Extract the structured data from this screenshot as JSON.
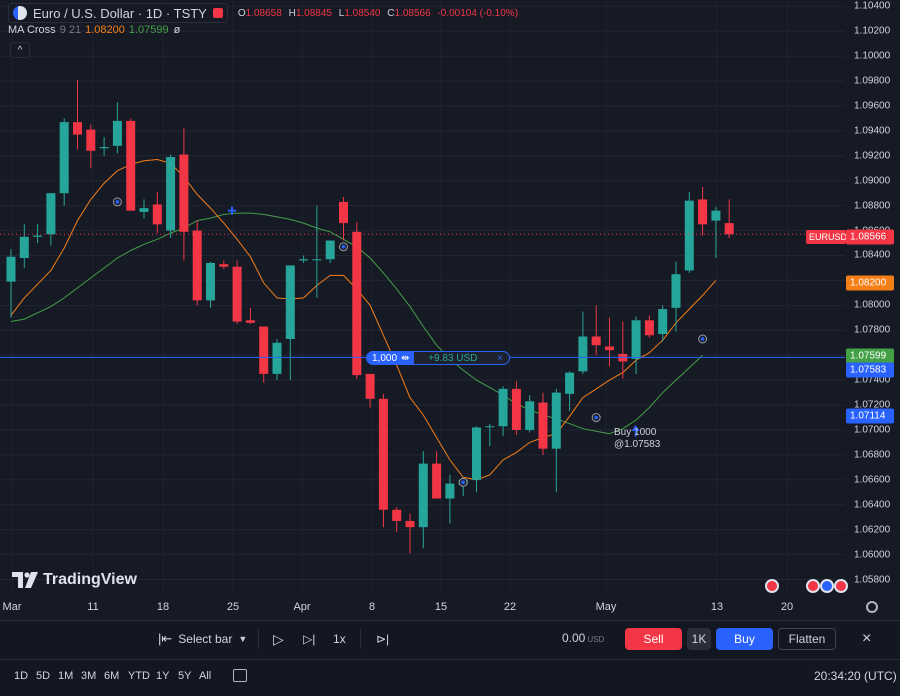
{
  "header": {
    "symbol_title": "Euro / U.S. Dollar · 1D · TSTY",
    "ohlc": {
      "o_label": "O",
      "o": "1.08658",
      "h_label": "H",
      "h": "1.08845",
      "l_label": "L",
      "l": "1.08540",
      "c_label": "C",
      "c": "1.08566",
      "change": "-0.00104 (-0.10%)"
    },
    "indicator": {
      "name": "MA Cross",
      "params": "9 21",
      "fast_value": "1.08200",
      "slow_value": "1.07599",
      "symbol": "ø"
    },
    "collapse_symbol": "^"
  },
  "price_axis": [
    "1.10400",
    "1.10200",
    "1.10000",
    "1.09800",
    "1.09600",
    "1.09400",
    "1.09200",
    "1.09000",
    "1.08800",
    "1.08600",
    "1.08400",
    "1.08200",
    "1.08000",
    "1.07800",
    "1.07600",
    "1.07400",
    "1.07200",
    "1.07000",
    "1.06800",
    "1.06600",
    "1.06400",
    "1.06200",
    "1.06000",
    "1.05800"
  ],
  "time_axis": [
    "Mar",
    "11",
    "18",
    "25",
    "Apr",
    "8",
    "15",
    "22",
    "May",
    "13",
    "20"
  ],
  "price_tags": {
    "symbol_tag": "EURUSD",
    "current": "1.08566",
    "fast_ma": "1.08200",
    "slow_ma": "1.07599",
    "entry": "1.07583",
    "low_line": "1.07114"
  },
  "position": {
    "qty": "1,000",
    "pnl": "+9.83 USD",
    "close_symbol": "×",
    "arrow_symbol": "⇹"
  },
  "buy_marker": {
    "line1": "Buy 1000",
    "line2": "@1.07583"
  },
  "brand": {
    "logo_text": "TradingView"
  },
  "colors": {
    "up": "#26a69a",
    "down": "#f23645",
    "fast_ma": "#f57f17",
    "slow_ma": "#43a047",
    "accent": "#2962ff",
    "background": "#161a25"
  },
  "chart_data": {
    "type": "candlestick",
    "y_range": [
      1.057,
      1.1045
    ],
    "grid": true,
    "candles": [
      {
        "o": 1.0819,
        "h": 1.0845,
        "l": 1.079,
        "c": 1.0839
      },
      {
        "o": 1.0838,
        "h": 1.0865,
        "l": 1.083,
        "c": 1.0855
      },
      {
        "o": 1.0855,
        "h": 1.0865,
        "l": 1.085,
        "c": 1.0856
      },
      {
        "o": 1.0857,
        "h": 1.087,
        "l": 1.0848,
        "c": 1.089
      },
      {
        "o": 1.089,
        "h": 1.095,
        "l": 1.088,
        "c": 1.0947
      },
      {
        "o": 1.0947,
        "h": 1.0981,
        "l": 1.0925,
        "c": 1.0937
      },
      {
        "o": 1.0941,
        "h": 1.0945,
        "l": 1.091,
        "c": 1.0924
      },
      {
        "o": 1.0926,
        "h": 1.0935,
        "l": 1.092,
        "c": 1.0927
      },
      {
        "o": 1.0928,
        "h": 1.0963,
        "l": 1.0922,
        "c": 1.0948
      },
      {
        "o": 1.0948,
        "h": 1.095,
        "l": 1.0876,
        "c": 1.0876
      },
      {
        "o": 1.0875,
        "h": 1.0885,
        "l": 1.087,
        "c": 1.0878
      },
      {
        "o": 1.0881,
        "h": 1.0891,
        "l": 1.0858,
        "c": 1.0865
      },
      {
        "o": 1.086,
        "h": 1.0921,
        "l": 1.0854,
        "c": 1.0919
      },
      {
        "o": 1.0921,
        "h": 1.0942,
        "l": 1.0836,
        "c": 1.0859
      },
      {
        "o": 1.086,
        "h": 1.0868,
        "l": 1.08,
        "c": 1.0804
      },
      {
        "o": 1.0804,
        "h": 1.0835,
        "l": 1.0798,
        "c": 1.0834
      },
      {
        "o": 1.0833,
        "h": 1.0836,
        "l": 1.0829,
        "c": 1.0831
      },
      {
        "o": 1.0831,
        "h": 1.0836,
        "l": 1.0785,
        "c": 1.0787
      },
      {
        "o": 1.0788,
        "h": 1.0798,
        "l": 1.0785,
        "c": 1.0786
      },
      {
        "o": 1.0783,
        "h": 1.0781,
        "l": 1.0738,
        "c": 1.0745
      },
      {
        "o": 1.0745,
        "h": 1.0773,
        "l": 1.074,
        "c": 1.077
      },
      {
        "o": 1.0773,
        "h": 1.083,
        "l": 1.074,
        "c": 1.0832
      },
      {
        "o": 1.0836,
        "h": 1.084,
        "l": 1.0834,
        "c": 1.0837
      },
      {
        "o": 1.0837,
        "h": 1.088,
        "l": 1.0806,
        "c": 1.0837
      },
      {
        "o": 1.0837,
        "h": 1.0848,
        "l": 1.0834,
        "c": 1.0852
      },
      {
        "o": 1.0883,
        "h": 1.0887,
        "l": 1.0852,
        "c": 1.0866
      },
      {
        "o": 1.0859,
        "h": 1.0867,
        "l": 1.0741,
        "c": 1.0744
      },
      {
        "o": 1.0745,
        "h": 1.0745,
        "l": 1.0718,
        "c": 1.0725
      },
      {
        "o": 1.0725,
        "h": 1.0729,
        "l": 1.0622,
        "c": 1.0636
      },
      {
        "o": 1.0636,
        "h": 1.0638,
        "l": 1.0618,
        "c": 1.0627
      },
      {
        "o": 1.0627,
        "h": 1.0633,
        "l": 1.0601,
        "c": 1.0622
      },
      {
        "o": 1.0622,
        "h": 1.0683,
        "l": 1.0605,
        "c": 1.0673
      },
      {
        "o": 1.0673,
        "h": 1.0683,
        "l": 1.0645,
        "c": 1.0645
      },
      {
        "o": 1.0645,
        "h": 1.0664,
        "l": 1.0625,
        "c": 1.0657
      },
      {
        "o": 1.0656,
        "h": 1.0662,
        "l": 1.0647,
        "c": 1.066
      },
      {
        "o": 1.066,
        "h": 1.0703,
        "l": 1.065,
        "c": 1.0702
      },
      {
        "o": 1.0703,
        "h": 1.0705,
        "l": 1.0687,
        "c": 1.0703
      },
      {
        "o": 1.0703,
        "h": 1.0735,
        "l": 1.0695,
        "c": 1.0733
      },
      {
        "o": 1.0733,
        "h": 1.0739,
        "l": 1.0696,
        "c": 1.07
      },
      {
        "o": 1.07,
        "h": 1.0728,
        "l": 1.0698,
        "c": 1.0723
      },
      {
        "o": 1.0722,
        "h": 1.073,
        "l": 1.068,
        "c": 1.0685
      },
      {
        "o": 1.0685,
        "h": 1.0733,
        "l": 1.065,
        "c": 1.073
      },
      {
        "o": 1.0729,
        "h": 1.0747,
        "l": 1.0715,
        "c": 1.0746
      },
      {
        "o": 1.0747,
        "h": 1.0795,
        "l": 1.0745,
        "c": 1.0775
      },
      {
        "o": 1.0775,
        "h": 1.08,
        "l": 1.076,
        "c": 1.0768
      },
      {
        "o": 1.0767,
        "h": 1.079,
        "l": 1.0751,
        "c": 1.0764
      },
      {
        "o": 1.0761,
        "h": 1.0787,
        "l": 1.0741,
        "c": 1.0755
      },
      {
        "o": 1.0757,
        "h": 1.0791,
        "l": 1.0745,
        "c": 1.0788
      },
      {
        "o": 1.0788,
        "h": 1.0792,
        "l": 1.0774,
        "c": 1.0776
      },
      {
        "o": 1.0777,
        "h": 1.08,
        "l": 1.0771,
        "c": 1.0797
      },
      {
        "o": 1.0798,
        "h": 1.0835,
        "l": 1.0779,
        "c": 1.0825
      },
      {
        "o": 1.0828,
        "h": 1.0891,
        "l": 1.0826,
        "c": 1.0884
      },
      {
        "o": 1.0885,
        "h": 1.0895,
        "l": 1.0856,
        "c": 1.0865
      },
      {
        "o": 1.0868,
        "h": 1.0879,
        "l": 1.0838,
        "c": 1.0876
      },
      {
        "o": 1.0866,
        "h": 1.0885,
        "l": 1.0854,
        "c": 1.0857
      }
    ],
    "fast_ma": [
      1.0792,
      1.0806,
      1.0817,
      1.0828,
      1.0846,
      1.0868,
      1.0885,
      1.0898,
      1.0908,
      1.0913,
      1.0916,
      1.0917,
      1.0914,
      1.0903,
      1.0889,
      1.0878,
      1.0866,
      1.0853,
      1.0839,
      1.0818,
      1.0806,
      1.0805,
      1.0806,
      1.0816,
      1.0824,
      1.0824,
      1.0813,
      1.08,
      1.0776,
      1.0752,
      1.0726,
      1.0712,
      1.0694,
      1.0676,
      1.0662,
      1.066,
      1.0664,
      1.0676,
      1.0682,
      1.069,
      1.0694,
      1.0697,
      1.0711,
      1.0726,
      1.0733,
      1.074,
      1.0746,
      1.0756,
      1.0762,
      1.0772,
      1.0786,
      1.0797,
      1.0808,
      1.082
    ],
    "slow_ma": [
      1.0787,
      1.0789,
      1.0794,
      1.0799,
      1.0806,
      1.0814,
      1.0822,
      1.083,
      1.0838,
      1.0844,
      1.0849,
      1.0853,
      1.0858,
      1.0862,
      1.0868,
      1.087,
      1.0873,
      1.0874,
      1.0874,
      1.0873,
      1.0871,
      1.0869,
      1.0866,
      1.0862,
      1.0859,
      1.0853,
      1.0847,
      1.0838,
      1.0826,
      1.0813,
      1.0799,
      1.0783,
      1.0768,
      1.0757,
      1.0748,
      1.074,
      1.0734,
      1.0728,
      1.0721,
      1.0716,
      1.0712,
      1.0709,
      1.0705,
      1.0701,
      1.0699,
      1.0697,
      1.0701,
      1.0708,
      1.0718,
      1.073,
      1.074,
      1.075,
      1.076
    ]
  },
  "replay_bar": {
    "select_bar": "Select bar",
    "speed": "1x",
    "pnl": "0.00",
    "pnl_currency": "USD",
    "sell": "Sell",
    "qty": "1K",
    "buy": "Buy",
    "flatten": "Flatten",
    "close": "×",
    "bar_icon": "|⇤",
    "play_icon": "▷",
    "step_icon": "▷|",
    "jump_icon": "⊳|"
  },
  "bottom_bar": {
    "timeframes": [
      "1D",
      "5D",
      "1M",
      "3M",
      "6M",
      "YTD",
      "1Y",
      "5Y",
      "All"
    ],
    "clock": "20:34:20 (UTC)"
  }
}
